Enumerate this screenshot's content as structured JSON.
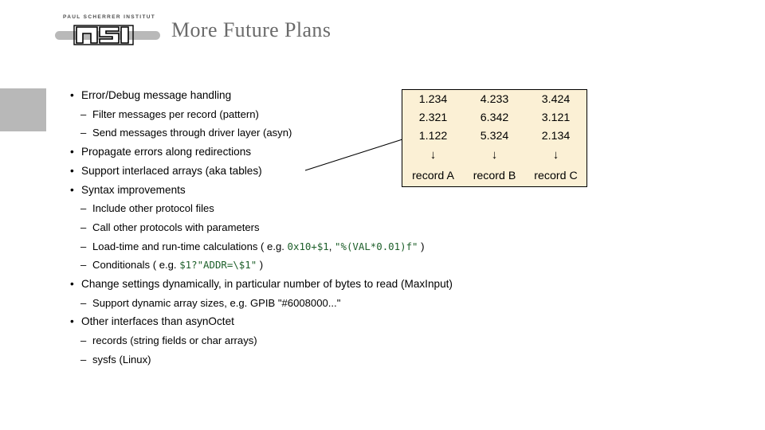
{
  "header": {
    "title": "More Future Plans",
    "logo": {
      "institute_name": "PAUL SCHERRER INSTITUT",
      "mark_text": "PSI"
    }
  },
  "content": {
    "rows": [
      {
        "level": 1,
        "marker": "•",
        "segments": [
          {
            "type": "text",
            "text": "Error/Debug message handling"
          }
        ]
      },
      {
        "level": 2,
        "marker": "–",
        "segments": [
          {
            "type": "text",
            "text": "Filter messages per record (pattern)"
          }
        ]
      },
      {
        "level": 2,
        "marker": "–",
        "segments": [
          {
            "type": "text",
            "text": "Send messages through driver layer (asyn)"
          }
        ]
      },
      {
        "level": 1,
        "marker": "•",
        "segments": [
          {
            "type": "text",
            "text": "Propagate errors along redirections"
          }
        ]
      },
      {
        "level": 1,
        "marker": "•",
        "segments": [
          {
            "type": "text",
            "text": "Support interlaced arrays (aka tables)"
          }
        ]
      },
      {
        "level": 1,
        "marker": "•",
        "segments": [
          {
            "type": "text",
            "text": "Syntax improvements"
          }
        ]
      },
      {
        "level": 2,
        "marker": "–",
        "segments": [
          {
            "type": "text",
            "text": "Include other protocol files"
          }
        ]
      },
      {
        "level": 2,
        "marker": "–",
        "segments": [
          {
            "type": "text",
            "text": "Call other protocols with parameters"
          }
        ]
      },
      {
        "level": 2,
        "marker": "–",
        "segments": [
          {
            "type": "text",
            "text": "Load-time and run-time calculations ( e.g. "
          },
          {
            "type": "code",
            "text": "0x10+$1"
          },
          {
            "type": "text",
            "text": ", "
          },
          {
            "type": "code",
            "text": "\"%(VAL*0.01)f\""
          },
          {
            "type": "text",
            "text": " )"
          }
        ]
      },
      {
        "level": 2,
        "marker": "–",
        "segments": [
          {
            "type": "text",
            "text": "Conditionals ( e.g. "
          },
          {
            "type": "code",
            "text": "$1?\"ADDR=\\$1\""
          },
          {
            "type": "text",
            "text": " )"
          }
        ]
      },
      {
        "level": 1,
        "marker": "•",
        "segments": [
          {
            "type": "text",
            "text": "Change settings dynamically, in particular number of bytes to read (MaxInput)"
          }
        ]
      },
      {
        "level": 2,
        "marker": "–",
        "segments": [
          {
            "type": "text",
            "text": "Support dynamic array sizes, e.g. GPIB \"#6008000...\""
          }
        ]
      },
      {
        "level": 1,
        "marker": "•",
        "segments": [
          {
            "type": "text",
            "text": "Other interfaces than asynOctet"
          }
        ]
      },
      {
        "level": 2,
        "marker": "–",
        "segments": [
          {
            "type": "text",
            "text": "records (string fields or char arrays)"
          }
        ]
      },
      {
        "level": 2,
        "marker": "–",
        "segments": [
          {
            "type": "text",
            "text": "sysfs (Linux)"
          }
        ]
      }
    ]
  },
  "record_table": {
    "rows": [
      [
        "1.234",
        "4.233",
        "3.424"
      ],
      [
        "2.321",
        "6.342",
        "3.121"
      ],
      [
        "1.122",
        "5.324",
        "2.134"
      ]
    ],
    "arrows": [
      "↓",
      "↓",
      "↓"
    ],
    "labels": [
      "record A",
      "record B",
      "record C"
    ],
    "background_color": "#fbf0d5",
    "border_color": "#000000"
  },
  "theme": {
    "accent_block_color": "#b8b8b8",
    "title_color": "#6a6a6a",
    "code_color": "#1d5f2a",
    "background_color": "#ffffff"
  }
}
